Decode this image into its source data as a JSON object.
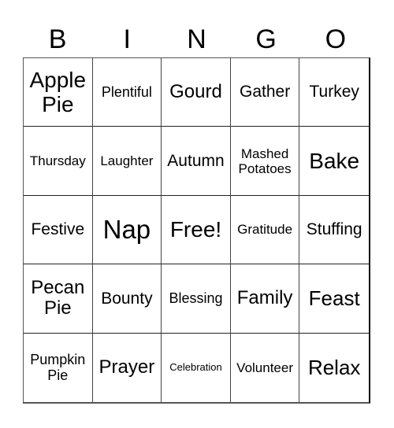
{
  "card": {
    "header": [
      "B",
      "I",
      "N",
      "G",
      "O"
    ],
    "cells": [
      [
        "Apple Pie",
        "Plentiful",
        "Gourd",
        "Gather",
        "Turkey"
      ],
      [
        "Thursday",
        "Laughter",
        "Autumn",
        "Mashed Potatoes",
        "Bake"
      ],
      [
        "Festive",
        "Nap",
        "Free!",
        "Gratitude",
        "Stuffing"
      ],
      [
        "Pecan Pie",
        "Bounty",
        "Blessing",
        "Family",
        "Feast"
      ],
      [
        "Pumpkin Pie",
        "Prayer",
        "Celebration",
        "Volunteer",
        "Relax"
      ]
    ],
    "free_space": "Free!"
  }
}
